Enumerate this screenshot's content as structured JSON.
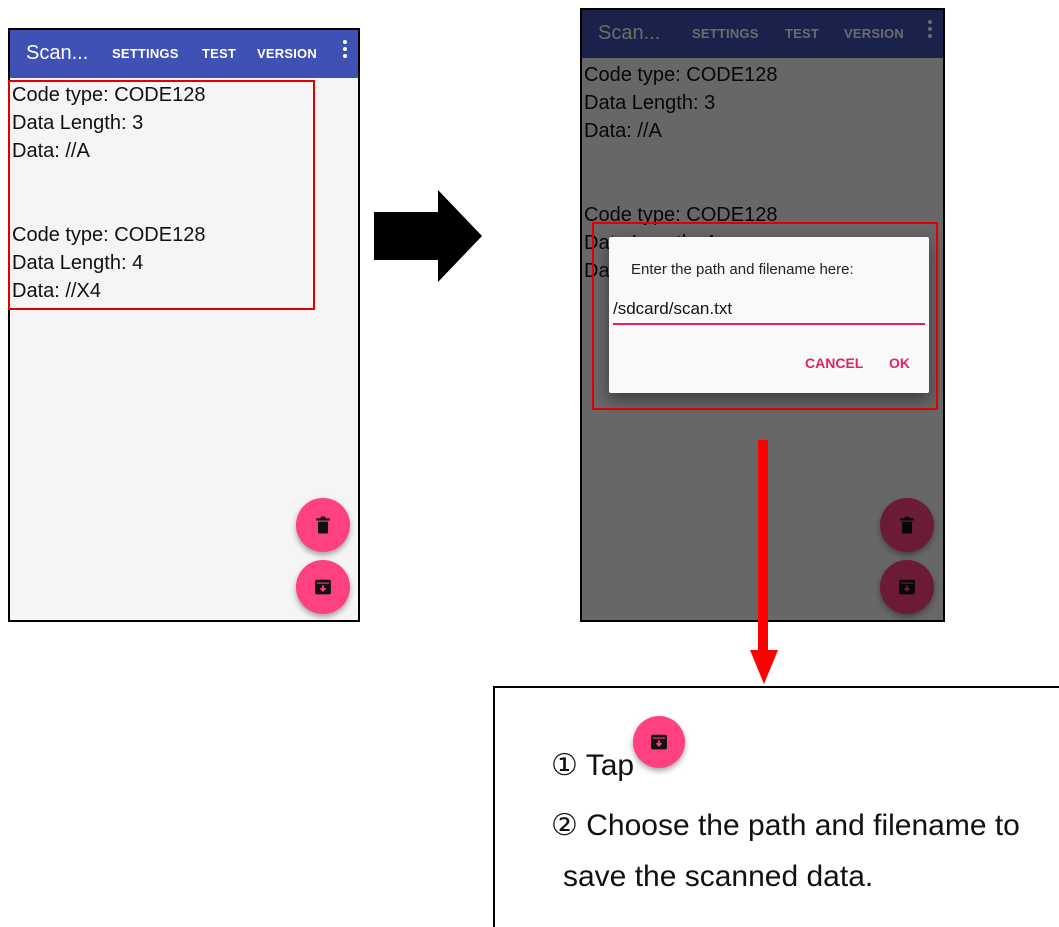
{
  "app": {
    "title": "Scan...",
    "menu": [
      "SETTINGS",
      "TEST",
      "VERSION"
    ]
  },
  "scan_results": [
    {
      "code_type": "Code type: CODE128",
      "length": "Data Length: 3",
      "data": "Data: //A"
    },
    {
      "code_type": "Code type: CODE128",
      "length": "Data Length: 4",
      "data": "Data: //X4"
    }
  ],
  "dialog": {
    "prompt": "Enter the path and filename here:",
    "value": "/sdcard/scan.txt",
    "cancel": "CANCEL",
    "ok": "OK"
  },
  "instructions": {
    "step1": "① Tap",
    "step2_line1": "② Choose the path and filename to",
    "step2_line2": "save the scanned data."
  },
  "colors": {
    "appbar": "#3f51b5",
    "fab": "#ff4081",
    "accent": "#e91e63",
    "highlight": "#e00000"
  },
  "icons": {
    "delete_fab": "trash-icon",
    "save_fab": "save-archive-icon",
    "overflow": "more-vert-icon"
  }
}
